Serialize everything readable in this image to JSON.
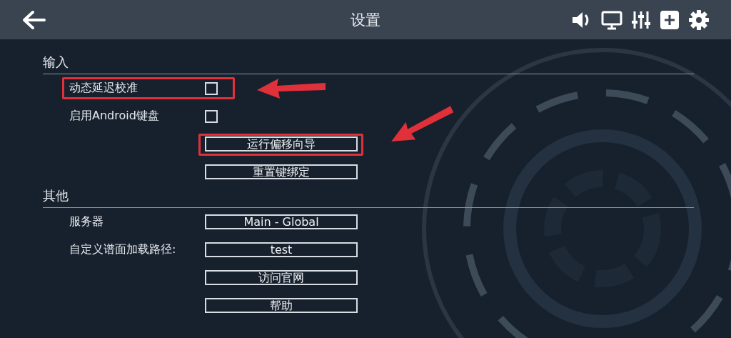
{
  "header": {
    "title": "设置"
  },
  "sections": [
    {
      "title": "输入",
      "rows": [
        {
          "kind": "checkbox",
          "label": "动态延迟校准",
          "checked": false,
          "highlighted": true
        },
        {
          "kind": "checkbox",
          "label": "启用Android键盘",
          "checked": false,
          "highlighted": false
        },
        {
          "kind": "button",
          "text": "运行偏移向导",
          "highlighted": true
        },
        {
          "kind": "button",
          "text": "重置键绑定",
          "highlighted": false
        }
      ]
    },
    {
      "title": "其他",
      "rows": [
        {
          "kind": "button",
          "label": "服务器",
          "text": "Main - Global",
          "highlighted": false
        },
        {
          "kind": "button",
          "label": "自定义谱面加载路径:",
          "text": "test",
          "highlighted": false
        },
        {
          "kind": "button",
          "text": "访问官网",
          "highlighted": false
        },
        {
          "kind": "button",
          "text": "帮助",
          "highlighted": false
        }
      ]
    }
  ]
}
